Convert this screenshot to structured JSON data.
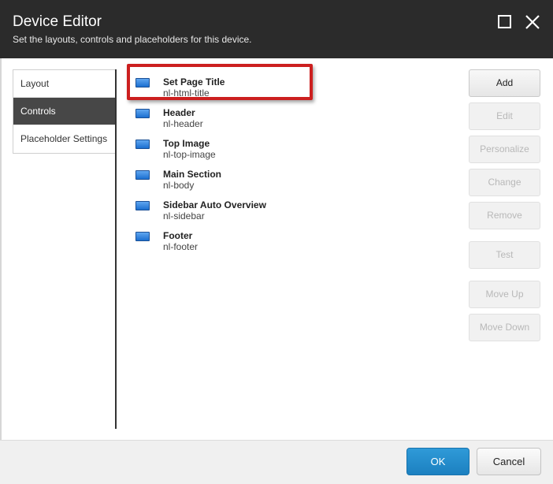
{
  "dialog": {
    "title": "Device Editor",
    "subtitle": "Set the layouts, controls and placeholders for this device."
  },
  "nav": {
    "items": [
      {
        "label": "Layout",
        "active": false
      },
      {
        "label": "Controls",
        "active": true
      },
      {
        "label": "Placeholder Settings",
        "active": false
      }
    ]
  },
  "controls": [
    {
      "name": "Set Page Title",
      "placeholder": "nl-html-title",
      "icon": "rendering-icon"
    },
    {
      "name": "Header",
      "placeholder": "nl-header",
      "icon": "rendering-icon"
    },
    {
      "name": "Top Image",
      "placeholder": "nl-top-image",
      "icon": "rendering-icon"
    },
    {
      "name": "Main Section",
      "placeholder": "nl-body",
      "icon": "rendering-icon"
    },
    {
      "name": "Sidebar Auto Overview",
      "placeholder": "nl-sidebar",
      "icon": "rendering-icon"
    },
    {
      "name": "Footer",
      "placeholder": "nl-footer",
      "icon": "rendering-icon"
    }
  ],
  "actions": {
    "add": "Add",
    "edit": "Edit",
    "personalize": "Personalize",
    "change": "Change",
    "remove": "Remove",
    "test": "Test",
    "move_up": "Move Up",
    "move_down": "Move Down"
  },
  "footer": {
    "ok": "OK",
    "cancel": "Cancel"
  },
  "colors": {
    "header_bg": "#2b2b2b",
    "active_nav_bg": "#474747",
    "ok_button": "#2f9ad8",
    "highlight_border": "#cc1f1f"
  }
}
